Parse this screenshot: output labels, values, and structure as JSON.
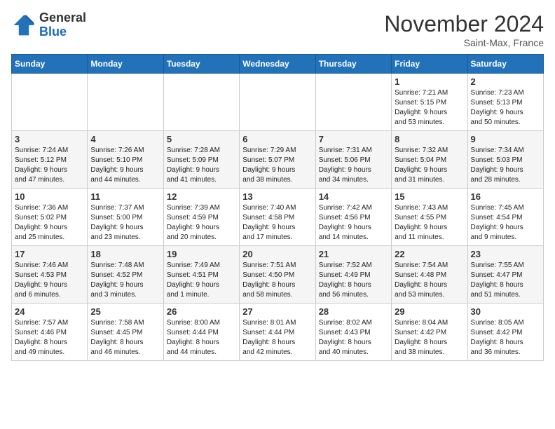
{
  "header": {
    "logo_line1": "General",
    "logo_line2": "Blue",
    "month_title": "November 2024",
    "location": "Saint-Max, France"
  },
  "weekdays": [
    "Sunday",
    "Monday",
    "Tuesday",
    "Wednesday",
    "Thursday",
    "Friday",
    "Saturday"
  ],
  "weeks": [
    [
      {
        "day": "",
        "info": ""
      },
      {
        "day": "",
        "info": ""
      },
      {
        "day": "",
        "info": ""
      },
      {
        "day": "",
        "info": ""
      },
      {
        "day": "",
        "info": ""
      },
      {
        "day": "1",
        "info": "Sunrise: 7:21 AM\nSunset: 5:15 PM\nDaylight: 9 hours\nand 53 minutes."
      },
      {
        "day": "2",
        "info": "Sunrise: 7:23 AM\nSunset: 5:13 PM\nDaylight: 9 hours\nand 50 minutes."
      }
    ],
    [
      {
        "day": "3",
        "info": "Sunrise: 7:24 AM\nSunset: 5:12 PM\nDaylight: 9 hours\nand 47 minutes."
      },
      {
        "day": "4",
        "info": "Sunrise: 7:26 AM\nSunset: 5:10 PM\nDaylight: 9 hours\nand 44 minutes."
      },
      {
        "day": "5",
        "info": "Sunrise: 7:28 AM\nSunset: 5:09 PM\nDaylight: 9 hours\nand 41 minutes."
      },
      {
        "day": "6",
        "info": "Sunrise: 7:29 AM\nSunset: 5:07 PM\nDaylight: 9 hours\nand 38 minutes."
      },
      {
        "day": "7",
        "info": "Sunrise: 7:31 AM\nSunset: 5:06 PM\nDaylight: 9 hours\nand 34 minutes."
      },
      {
        "day": "8",
        "info": "Sunrise: 7:32 AM\nSunset: 5:04 PM\nDaylight: 9 hours\nand 31 minutes."
      },
      {
        "day": "9",
        "info": "Sunrise: 7:34 AM\nSunset: 5:03 PM\nDaylight: 9 hours\nand 28 minutes."
      }
    ],
    [
      {
        "day": "10",
        "info": "Sunrise: 7:36 AM\nSunset: 5:02 PM\nDaylight: 9 hours\nand 25 minutes."
      },
      {
        "day": "11",
        "info": "Sunrise: 7:37 AM\nSunset: 5:00 PM\nDaylight: 9 hours\nand 23 minutes."
      },
      {
        "day": "12",
        "info": "Sunrise: 7:39 AM\nSunset: 4:59 PM\nDaylight: 9 hours\nand 20 minutes."
      },
      {
        "day": "13",
        "info": "Sunrise: 7:40 AM\nSunset: 4:58 PM\nDaylight: 9 hours\nand 17 minutes."
      },
      {
        "day": "14",
        "info": "Sunrise: 7:42 AM\nSunset: 4:56 PM\nDaylight: 9 hours\nand 14 minutes."
      },
      {
        "day": "15",
        "info": "Sunrise: 7:43 AM\nSunset: 4:55 PM\nDaylight: 9 hours\nand 11 minutes."
      },
      {
        "day": "16",
        "info": "Sunrise: 7:45 AM\nSunset: 4:54 PM\nDaylight: 9 hours\nand 9 minutes."
      }
    ],
    [
      {
        "day": "17",
        "info": "Sunrise: 7:46 AM\nSunset: 4:53 PM\nDaylight: 9 hours\nand 6 minutes."
      },
      {
        "day": "18",
        "info": "Sunrise: 7:48 AM\nSunset: 4:52 PM\nDaylight: 9 hours\nand 3 minutes."
      },
      {
        "day": "19",
        "info": "Sunrise: 7:49 AM\nSunset: 4:51 PM\nDaylight: 9 hours\nand 1 minute."
      },
      {
        "day": "20",
        "info": "Sunrise: 7:51 AM\nSunset: 4:50 PM\nDaylight: 8 hours\nand 58 minutes."
      },
      {
        "day": "21",
        "info": "Sunrise: 7:52 AM\nSunset: 4:49 PM\nDaylight: 8 hours\nand 56 minutes."
      },
      {
        "day": "22",
        "info": "Sunrise: 7:54 AM\nSunset: 4:48 PM\nDaylight: 8 hours\nand 53 minutes."
      },
      {
        "day": "23",
        "info": "Sunrise: 7:55 AM\nSunset: 4:47 PM\nDaylight: 8 hours\nand 51 minutes."
      }
    ],
    [
      {
        "day": "24",
        "info": "Sunrise: 7:57 AM\nSunset: 4:46 PM\nDaylight: 8 hours\nand 49 minutes."
      },
      {
        "day": "25",
        "info": "Sunrise: 7:58 AM\nSunset: 4:45 PM\nDaylight: 8 hours\nand 46 minutes."
      },
      {
        "day": "26",
        "info": "Sunrise: 8:00 AM\nSunset: 4:44 PM\nDaylight: 8 hours\nand 44 minutes."
      },
      {
        "day": "27",
        "info": "Sunrise: 8:01 AM\nSunset: 4:44 PM\nDaylight: 8 hours\nand 42 minutes."
      },
      {
        "day": "28",
        "info": "Sunrise: 8:02 AM\nSunset: 4:43 PM\nDaylight: 8 hours\nand 40 minutes."
      },
      {
        "day": "29",
        "info": "Sunrise: 8:04 AM\nSunset: 4:42 PM\nDaylight: 8 hours\nand 38 minutes."
      },
      {
        "day": "30",
        "info": "Sunrise: 8:05 AM\nSunset: 4:42 PM\nDaylight: 8 hours\nand 36 minutes."
      }
    ]
  ]
}
